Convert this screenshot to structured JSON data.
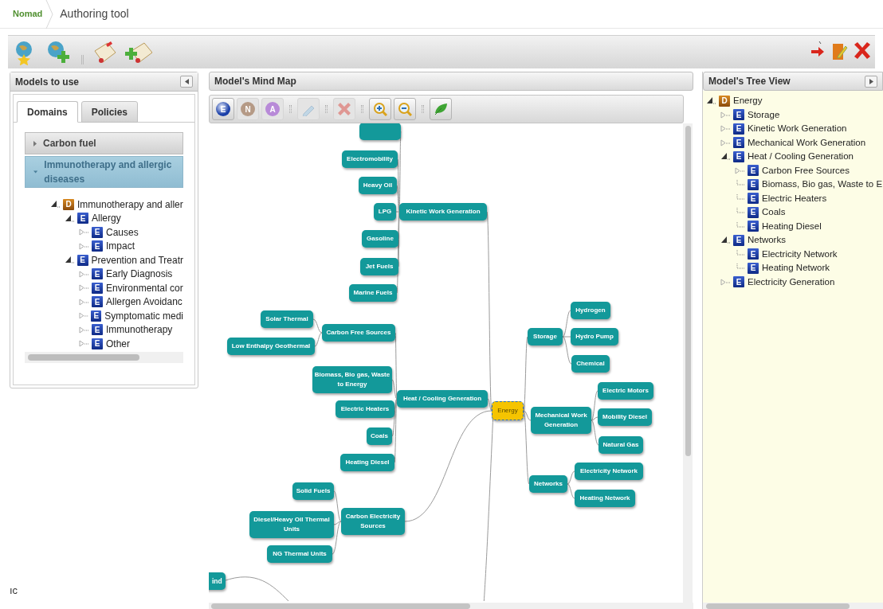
{
  "breadcrumb": [
    {
      "label": "Nomad",
      "kind": "home"
    },
    {
      "label": "Authoring tool",
      "kind": "current"
    }
  ],
  "main_toolbar": {
    "left": [
      {
        "kind": "globe-star"
      },
      {
        "kind": "globe-plus"
      },
      {
        "kind": "separator"
      },
      {
        "kind": "scroll-edit"
      },
      {
        "kind": "scroll-plus"
      }
    ],
    "right": [
      {
        "kind": "arrow"
      },
      {
        "kind": "door"
      },
      {
        "kind": "close"
      }
    ]
  },
  "models_panel": {
    "title": "Models to use",
    "tabs": [
      {
        "label": "Domains",
        "selected": true
      },
      {
        "label": "Policies",
        "selected": false
      }
    ],
    "accordion": [
      {
        "label": "Carbon fuel",
        "expanded": false
      },
      {
        "label": "Immunotherapy and allergic diseases",
        "expanded": true
      }
    ],
    "tree": [
      {
        "label": "Immunotherapy and aller",
        "badge": "D",
        "kind": "domain",
        "has_children": true,
        "expanded": true,
        "children": [
          {
            "label": "Allergy",
            "badge": "E",
            "kind": "element",
            "has_children": true,
            "expanded": true,
            "children": [
              {
                "label": "Causes",
                "badge": "E",
                "kind": "element",
                "has_children": true,
                "expanded": false
              },
              {
                "label": "Impact",
                "badge": "E",
                "kind": "element",
                "has_children": true,
                "expanded": false
              }
            ]
          },
          {
            "label": "Prevention and Treatr",
            "badge": "E",
            "kind": "element",
            "has_children": true,
            "expanded": true,
            "children": [
              {
                "label": "Early Diagnosis",
                "badge": "E",
                "kind": "element",
                "has_children": true,
                "expanded": false
              },
              {
                "label": "Environmental cor",
                "badge": "E",
                "kind": "element",
                "has_children": true,
                "expanded": false
              },
              {
                "label": "Allergen Avoidanc",
                "badge": "E",
                "kind": "element",
                "has_children": true,
                "expanded": false
              },
              {
                "label": "Symptomatic medi",
                "badge": "E",
                "kind": "element",
                "has_children": true,
                "expanded": false
              },
              {
                "label": "Immunotherapy",
                "badge": "E",
                "kind": "element",
                "has_children": true,
                "expanded": false
              },
              {
                "label": "Other",
                "badge": "E",
                "kind": "element",
                "has_children": true,
                "expanded": false
              }
            ]
          }
        ]
      }
    ]
  },
  "mind_map_panel": {
    "title": "Model's Mind Map",
    "toolbar": [
      {
        "kind": "entity",
        "label": "E",
        "disabled": false
      },
      {
        "kind": "node",
        "label": "N",
        "disabled": true
      },
      {
        "kind": "attribute",
        "label": "A",
        "disabled": true
      },
      {
        "kind": "separator"
      },
      {
        "kind": "edit",
        "disabled": true
      },
      {
        "kind": "separator"
      },
      {
        "kind": "delete",
        "disabled": true
      },
      {
        "kind": "separator"
      },
      {
        "kind": "zoom-in",
        "disabled": false
      },
      {
        "kind": "zoom-out",
        "disabled": false
      },
      {
        "kind": "separator"
      },
      {
        "kind": "leaf",
        "disabled": false
      }
    ],
    "root": {
      "label": "Energy",
      "kind": "root",
      "children": [
        {
          "label": "Kinetic Work Generation",
          "children": [
            {
              "clipped": true
            },
            {
              "label": "Electromobility"
            },
            {
              "label": "Heavy Oil"
            },
            {
              "label": "LPG"
            },
            {
              "label": "Gasoline"
            },
            {
              "label": "Jet Fuels"
            },
            {
              "label": "Marine Fuels"
            }
          ]
        },
        {
          "label": "Heat / Cooling Generation",
          "children": [
            {
              "label": "Carbon Free Sources",
              "children": [
                {
                  "label": "Solar Thermal"
                },
                {
                  "label": "Low Enthalpy Geothermal"
                }
              ]
            },
            {
              "label": "Biomass, Bio gas, Waste to Energy"
            },
            {
              "label": "Electric Heaters"
            },
            {
              "label": "Coals"
            },
            {
              "label": "Heating Diesel"
            }
          ]
        },
        {
          "label": "Carbon Electricity Sources",
          "children": [
            {
              "label": "Solid Fuels"
            },
            {
              "label": "Diesel/Heavy Oil  Thermal Units"
            },
            {
              "label": "NG  Thermal  Units"
            }
          ]
        },
        {
          "label": "Storage",
          "children": [
            {
              "label": "Hydrogen"
            },
            {
              "label": "Hydro Pump"
            },
            {
              "label": "Chemical"
            }
          ]
        },
        {
          "label": "Mechanical Work Generation",
          "children": [
            {
              "label": "Electric Motors"
            },
            {
              "label": "Mobility Diesel"
            },
            {
              "label": "Natural Gas"
            }
          ]
        },
        {
          "label": "Networks",
          "children": [
            {
              "label": "Electricity Network"
            },
            {
              "label": "Heating Network"
            }
          ]
        }
      ]
    },
    "edge_nodes": [
      {
        "label": "ind"
      }
    ]
  },
  "tree_panel": {
    "title": "Model's Tree View",
    "tree": [
      {
        "label": "Energy",
        "badge": "D",
        "kind": "domain",
        "has_children": true,
        "expanded": true,
        "children": [
          {
            "label": "Storage",
            "badge": "E",
            "kind": "element",
            "has_children": true,
            "expanded": false
          },
          {
            "label": "Kinetic Work Generation",
            "badge": "E",
            "kind": "element",
            "has_children": true,
            "expanded": false
          },
          {
            "label": "Mechanical Work Generation",
            "badge": "E",
            "kind": "element",
            "has_children": true,
            "expanded": false
          },
          {
            "label": "Heat / Cooling Generation",
            "badge": "E",
            "kind": "element",
            "has_children": true,
            "expanded": true,
            "children": [
              {
                "label": "Carbon Free Sources",
                "badge": "E",
                "kind": "element",
                "has_children": true,
                "expanded": false
              },
              {
                "label": "Biomass, Bio gas, Waste to E",
                "badge": "E",
                "kind": "element",
                "has_children": false
              },
              {
                "label": "Electric Heaters",
                "badge": "E",
                "kind": "element",
                "has_children": false
              },
              {
                "label": "Coals",
                "badge": "E",
                "kind": "element",
                "has_children": false
              },
              {
                "label": "Heating Diesel",
                "badge": "E",
                "kind": "element",
                "has_children": false
              }
            ]
          },
          {
            "label": "Networks",
            "badge": "E",
            "kind": "element",
            "has_children": true,
            "expanded": true,
            "children": [
              {
                "label": "Electricity Network",
                "badge": "E",
                "kind": "element",
                "has_children": false
              },
              {
                "label": "Heating Network",
                "badge": "E",
                "kind": "element",
                "has_children": false
              }
            ]
          },
          {
            "label": "Electricity Generation",
            "badge": "E",
            "kind": "element",
            "has_children": true,
            "expanded": false
          }
        ]
      }
    ]
  },
  "stray_text": "ıc"
}
